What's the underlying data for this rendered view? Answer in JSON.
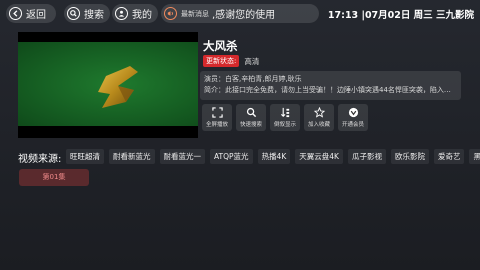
{
  "topbar": {
    "back_label": "返回",
    "search_label": "搜索",
    "mine_label": "我的",
    "news_tag": "最新消息",
    "news_text": ",感谢您的使用",
    "clock": "17:13 |07月02日 周三  三九影院"
  },
  "movie": {
    "title": "大风杀",
    "status_badge": "更新状态:",
    "status_value": "高清",
    "cast": "演员：白客,辛柏青,郎月婷,耿乐",
    "intro": "简介：此接口完全免费，请勿上当受骗！！边陲小镇突遇44名悍匪突袭，陷入了断..."
  },
  "actions": [
    {
      "icon": "fullscreen-icon",
      "label": "全屏播放"
    },
    {
      "icon": "search-icon",
      "label": "快速搜索"
    },
    {
      "icon": "sort-icon",
      "label": "倒叙显示"
    },
    {
      "icon": "star-icon",
      "label": "加入收藏"
    },
    {
      "icon": "vip-icon",
      "label": "开通会员"
    }
  ],
  "sources": {
    "label": "视频来源:",
    "items": [
      "旺旺超清",
      "耐看新蓝光",
      "耐看蓝光一",
      "ATQP蓝光",
      "热播4K",
      "天翼云盘4K",
      "瓜子影视",
      "欧乐影院",
      "爱奇艺",
      "黑"
    ]
  },
  "episode_label": "第01集",
  "colors": {
    "accent": "#d4292c",
    "background": "#1f2127"
  }
}
